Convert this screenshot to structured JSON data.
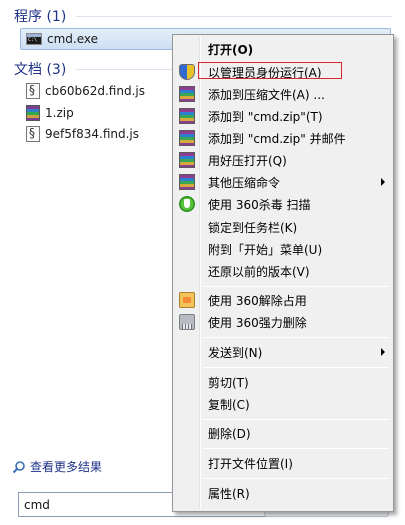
{
  "results": {
    "programs_header": "程序 (1)",
    "cmd_label": "cmd.exe",
    "documents_header": "文档 (3)",
    "documents": [
      {
        "label": "cb60b62d.find.js",
        "icon": "js-file-icon"
      },
      {
        "label": "1.zip",
        "icon": "zip-file-icon"
      },
      {
        "label": "9ef5f834.find.js",
        "icon": "js-file-icon"
      }
    ],
    "see_more": "查看更多结果",
    "search_value": "cmd"
  },
  "menu": {
    "open": "打开(O)",
    "run_as_admin": "以管理员身份运行(A)",
    "add_to_archive": "添加到压缩文件(A) ...",
    "add_to_cmd_zip": "添加到 \"cmd.zip\"(T)",
    "add_to_cmd_zip_mail": "添加到 \"cmd.zip\" 并邮件",
    "open_with_haozip": "用好压打开(Q)",
    "other_compress": "其他压缩命令",
    "scan_360": "使用 360杀毒 扫描",
    "pin_taskbar": "锁定到任务栏(K)",
    "pin_start": "附到「开始」菜单(U)",
    "restore_previous": "还原以前的版本(V)",
    "unlock_360": "使用 360解除占用",
    "force_delete_360": "使用 360强力删除",
    "send_to": "发送到(N)",
    "cut": "剪切(T)",
    "copy": "复制(C)",
    "delete": "删除(D)",
    "open_location": "打开文件位置(I)",
    "properties": "属性(R)"
  },
  "colors": {
    "accent_header": "#1e3287",
    "selection": "#cddff4",
    "highlight_border": "#d7262d"
  }
}
